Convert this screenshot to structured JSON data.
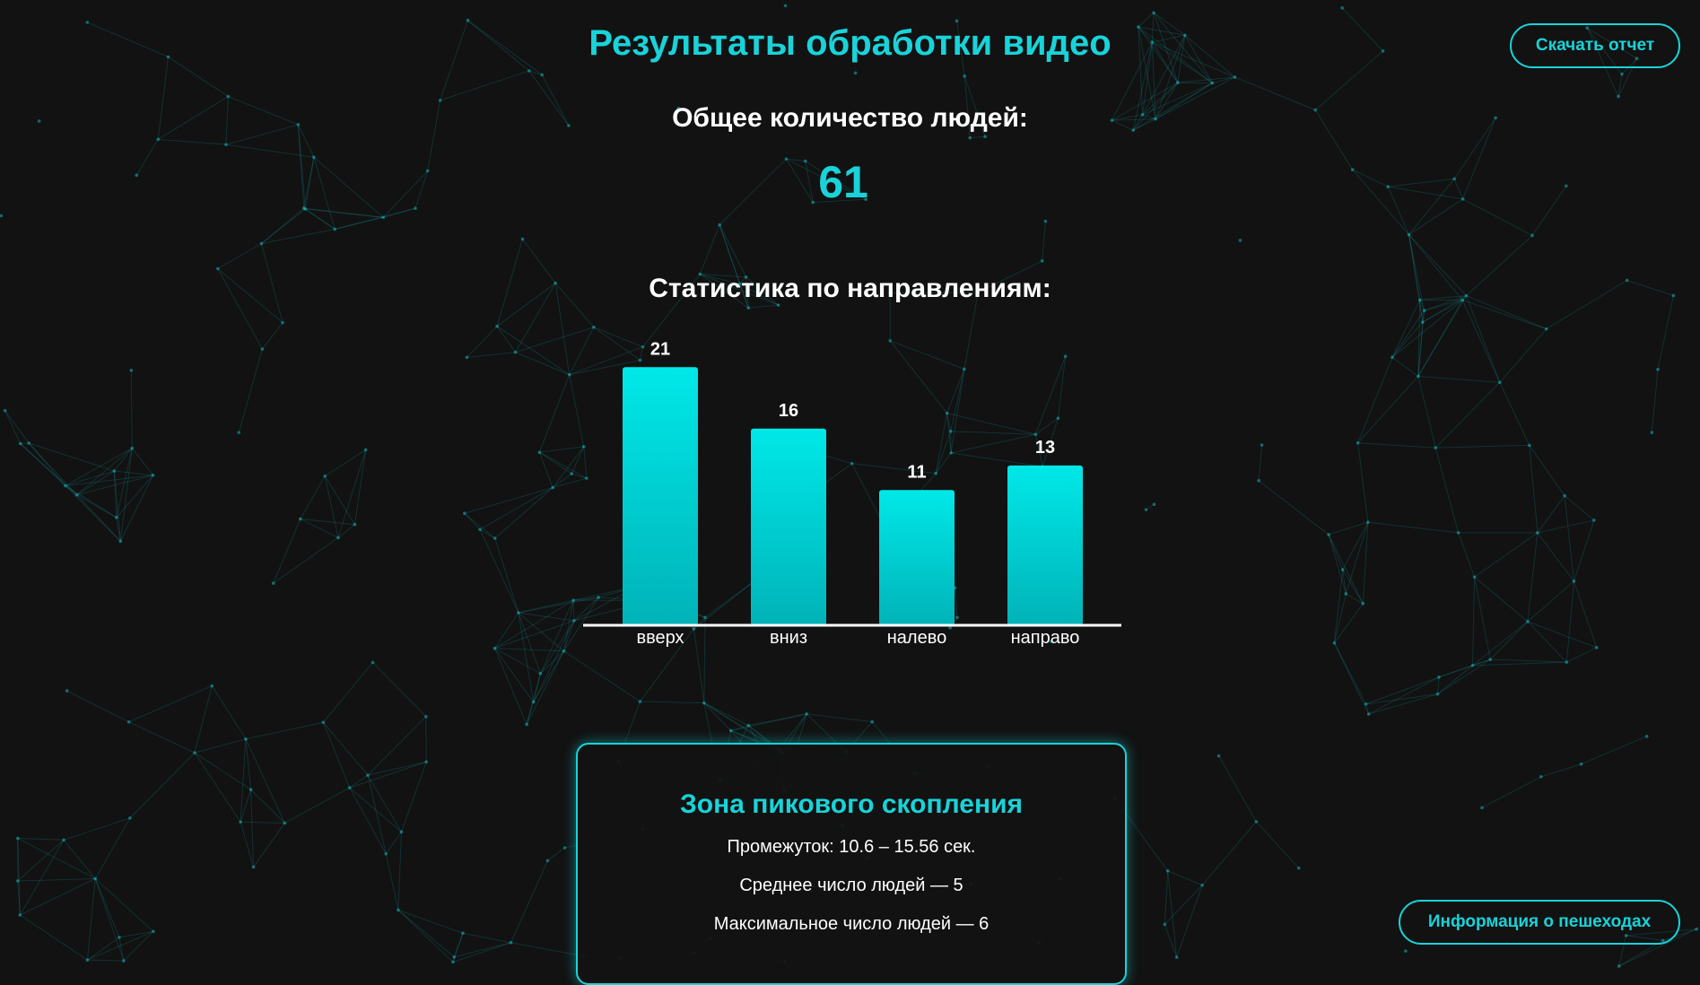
{
  "header": {
    "title": "Результаты обработки видео",
    "download_label": "Скачать отчет"
  },
  "summary": {
    "total_label": "Общее количество людей:",
    "total_value": "61",
    "directions_label": "Статистика по направлениям:"
  },
  "chart_data": {
    "type": "bar",
    "categories": [
      "вверх",
      "вниз",
      "налево",
      "направо"
    ],
    "values": [
      21,
      16,
      11,
      13
    ],
    "title": "",
    "xlabel": "",
    "ylabel": "",
    "grid": false,
    "value_labels": true,
    "bar_color_top": "#00e8e8",
    "bar_color_bottom": "#00b3b8"
  },
  "peak": {
    "title": "Зона пикового скопления",
    "interval": "Промежуток: 10.6 – 15.56 сек.",
    "average": "Среднее число людей — 5",
    "maximum": "Максимальное число людей — 6"
  },
  "footer": {
    "pedestrians_label": "Информация о пешеходах"
  },
  "colors": {
    "accent": "#19d3d9",
    "background": "#121212",
    "text": "#ffffff"
  }
}
